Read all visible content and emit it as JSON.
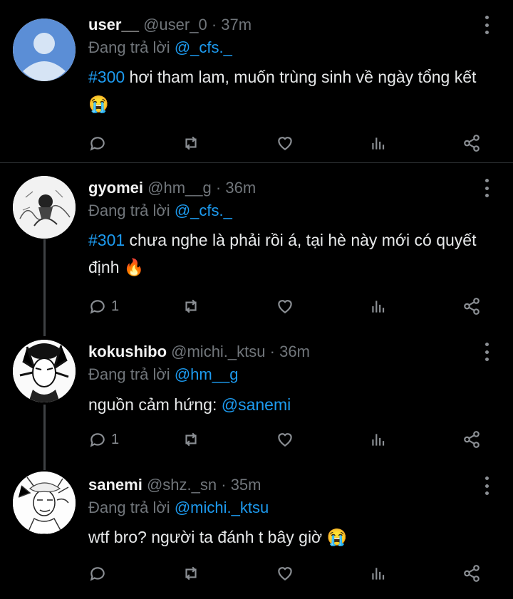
{
  "tweets": [
    {
      "name": "user__",
      "handle": "@user_0",
      "time": "37m",
      "reply_prefix": "Đang trả lời",
      "reply_to": "@_cfs._",
      "tag": "#300",
      "text": " hơi tham lam, muốn trùng sinh về ngày tổng kết 😭",
      "reply_count": "",
      "avatar": "default-avatar"
    },
    {
      "name": "gyomei",
      "handle": "@hm__g",
      "time": "36m",
      "reply_prefix": "Đang trả lời",
      "reply_to": "@_cfs._",
      "tag": "#301",
      "text": " chưa nghe là phải rồi á, tại hè này mới có quyết định 🔥",
      "reply_count": "1",
      "avatar": "manga-avatar"
    },
    {
      "name": "kokushibo",
      "handle": "@michi._ktsu",
      "time": "36m",
      "reply_prefix": "Đang trả lời",
      "reply_to": "@hm__g",
      "text": "nguồn cảm hứng: ",
      "mention": "@sanemi",
      "reply_count": "1",
      "avatar": "manga-avatar"
    },
    {
      "name": "sanemi",
      "handle": "@shz._sn",
      "time": "35m",
      "reply_prefix": "Đang trả lời",
      "reply_to": "@michi._ktsu",
      "text": "wtf bro? người ta đánh t bây giờ 😭",
      "reply_count": "",
      "avatar": "manga-avatar"
    }
  ],
  "sep": "·",
  "icons": [
    "reply-icon",
    "retweet-icon",
    "like-icon",
    "views-icon",
    "share-icon",
    "more-icon"
  ],
  "colors": {
    "background": "#000000",
    "link": "#1d9bf0",
    "muted": "#71767b",
    "text": "#e7e9ea",
    "divider": "#2f3336"
  }
}
